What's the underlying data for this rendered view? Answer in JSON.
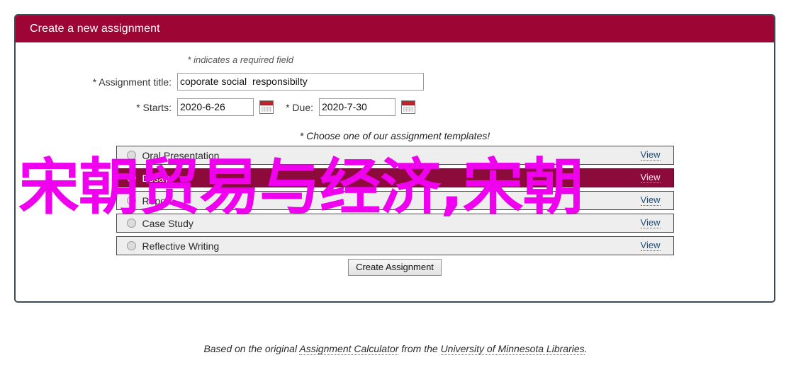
{
  "window": {
    "title": "Create a new assignment"
  },
  "form": {
    "required_note": "* indicates a required field",
    "title_label": "* Assignment title:",
    "title_value": "coporate social  responsibilty",
    "title_placeholder": "",
    "starts_label": "* Starts:",
    "starts_value": "2020-6-26",
    "due_label": "* Due:",
    "due_value": "2020-7-30",
    "starts_calendar_icon": "calendar-icon",
    "due_calendar_icon": "calendar-icon"
  },
  "templates": {
    "choose_note": "* Choose one of our assignment templates!",
    "view_label": "View",
    "items": [
      {
        "name": "Oral Presentation",
        "selected": false
      },
      {
        "name": "Essay",
        "selected": true
      },
      {
        "name": "Report",
        "selected": false
      },
      {
        "name": "Case Study",
        "selected": false
      },
      {
        "name": "Reflective Writing",
        "selected": false
      }
    ]
  },
  "actions": {
    "create_label": "Create Assignment"
  },
  "footer": {
    "prefix": "Based on the original ",
    "link1": "Assignment Calculator",
    "middle": " from the ",
    "link2": "University of Minnesota Libraries",
    "suffix": "."
  },
  "overlay": {
    "text": "宋朝贸易与经济,宋朝",
    "color": "#ef00ef"
  },
  "colors": {
    "titlebar": "#9c0534",
    "selected_row": "#8d0b3b",
    "panel_border": "#3d4b56",
    "row_background": "#eeeeee"
  }
}
